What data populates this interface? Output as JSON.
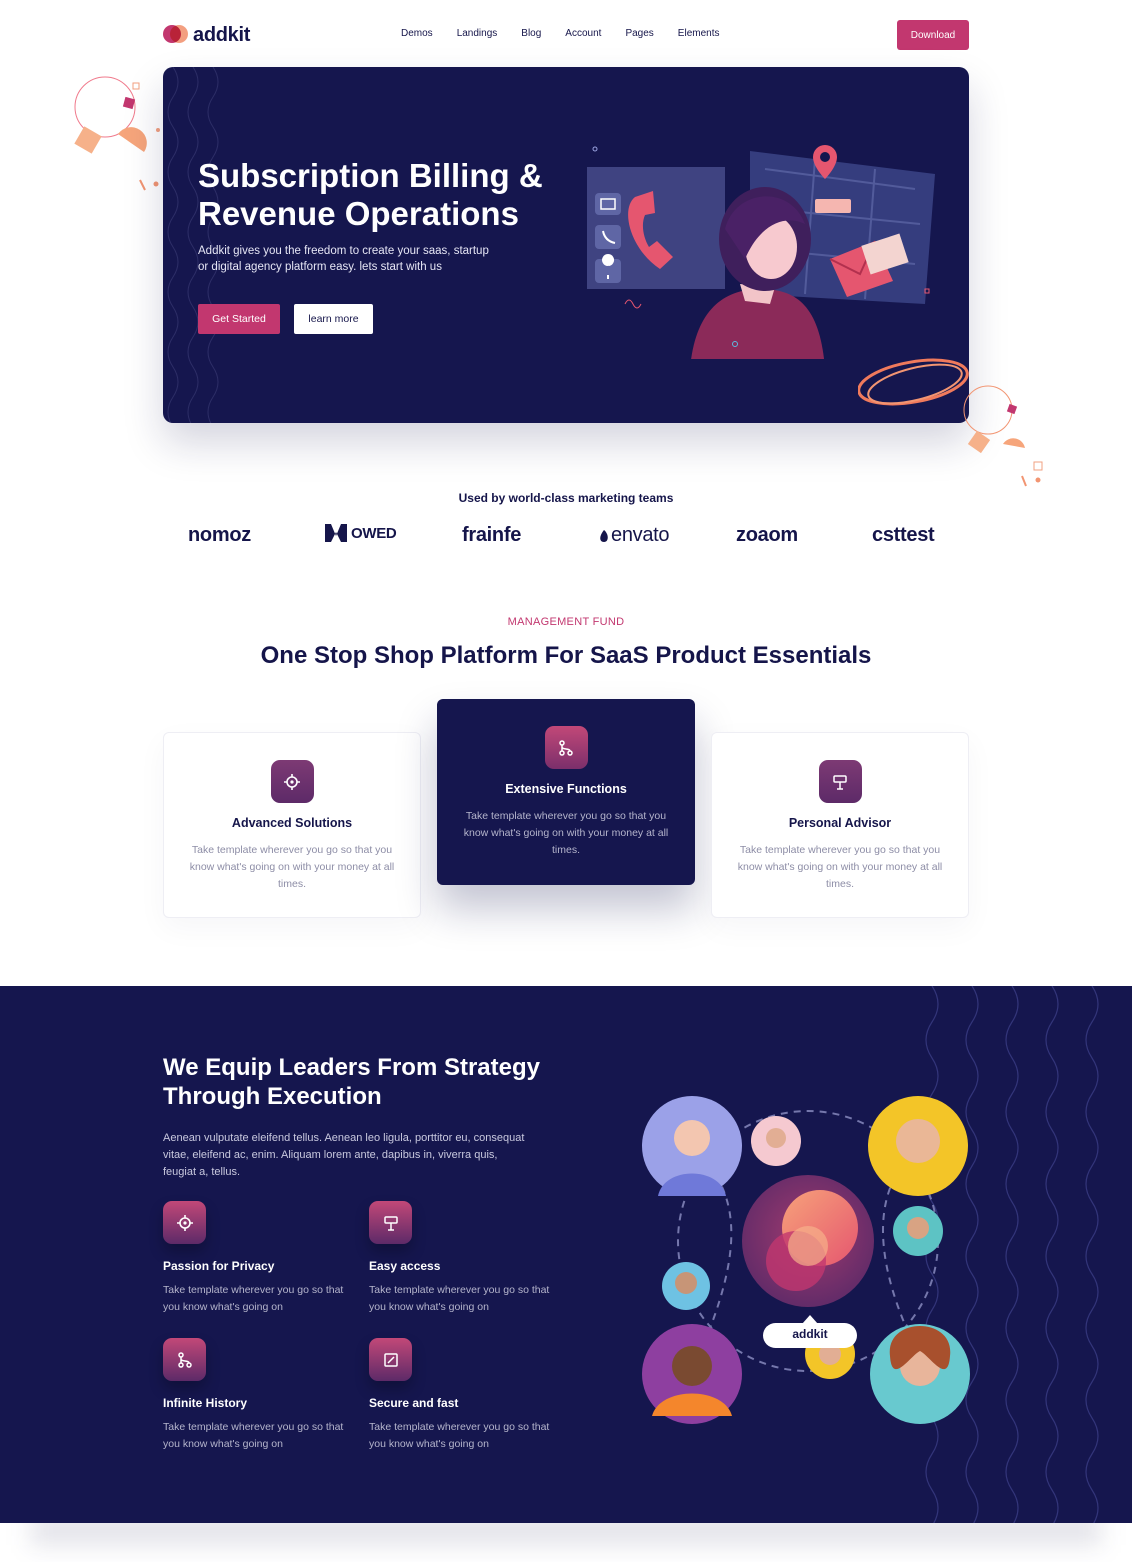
{
  "brand": {
    "name": "addkit"
  },
  "nav": {
    "items": [
      "Demos",
      "Landings",
      "Blog",
      "Account",
      "Pages",
      "Elements"
    ],
    "download_label": "Download"
  },
  "hero": {
    "title": "Subscription Billing & Revenue Operations",
    "subtitle": "Addkit gives you the freedom to create your saas, startup or digital agency platform easy. lets start with us",
    "primary_label": "Get Started",
    "secondary_label": "learn more"
  },
  "logos": {
    "heading": "Used by world-class marketing teams",
    "items": [
      "nomoz",
      "OWED",
      "frainfe",
      "envato",
      "zoaom",
      "csttest"
    ]
  },
  "features": {
    "eyebrow": "MANAGEMENT FUND",
    "title": "One Stop Shop Platform For SaaS Product Essentials",
    "cards": [
      {
        "title": "Advanced Solutions",
        "text": "Take template wherever you go so that you know what's going on with your money at all times.",
        "icon": "target-icon"
      },
      {
        "title": "Extensive Functions",
        "text": "Take template wherever you go so that you know what's going on with your money at all times.",
        "icon": "branch-icon"
      },
      {
        "title": "Personal Advisor",
        "text": "Take template wherever you go so that you know what's going on with your money at all times.",
        "icon": "sign-icon"
      }
    ]
  },
  "leaders": {
    "title": "We Equip Leaders From Strategy Through Execution",
    "text": "Aenean vulputate eleifend tellus. Aenean leo ligula, porttitor eu, consequat vitae, eleifend ac, enim. Aliquam lorem ante, dapibus in, viverra quis, feugiat a, tellus.",
    "items": [
      {
        "title": "Passion for Privacy",
        "text": "Take template wherever you go so that you know what's going on",
        "icon": "target-icon"
      },
      {
        "title": "Easy access",
        "text": "Take template wherever you go so that you know what's going on",
        "icon": "sign-icon"
      },
      {
        "title": "Infinite History",
        "text": "Take template wherever you go so that you know what's going on",
        "icon": "branch-icon"
      },
      {
        "title": "Secure and fast",
        "text": "Take template wherever you go so that you know what's going on",
        "icon": "note-icon"
      }
    ],
    "network_label": "addkit"
  },
  "colors": {
    "navy": "#15164e",
    "accent": "#c2376f",
    "peach": "#f29572"
  }
}
